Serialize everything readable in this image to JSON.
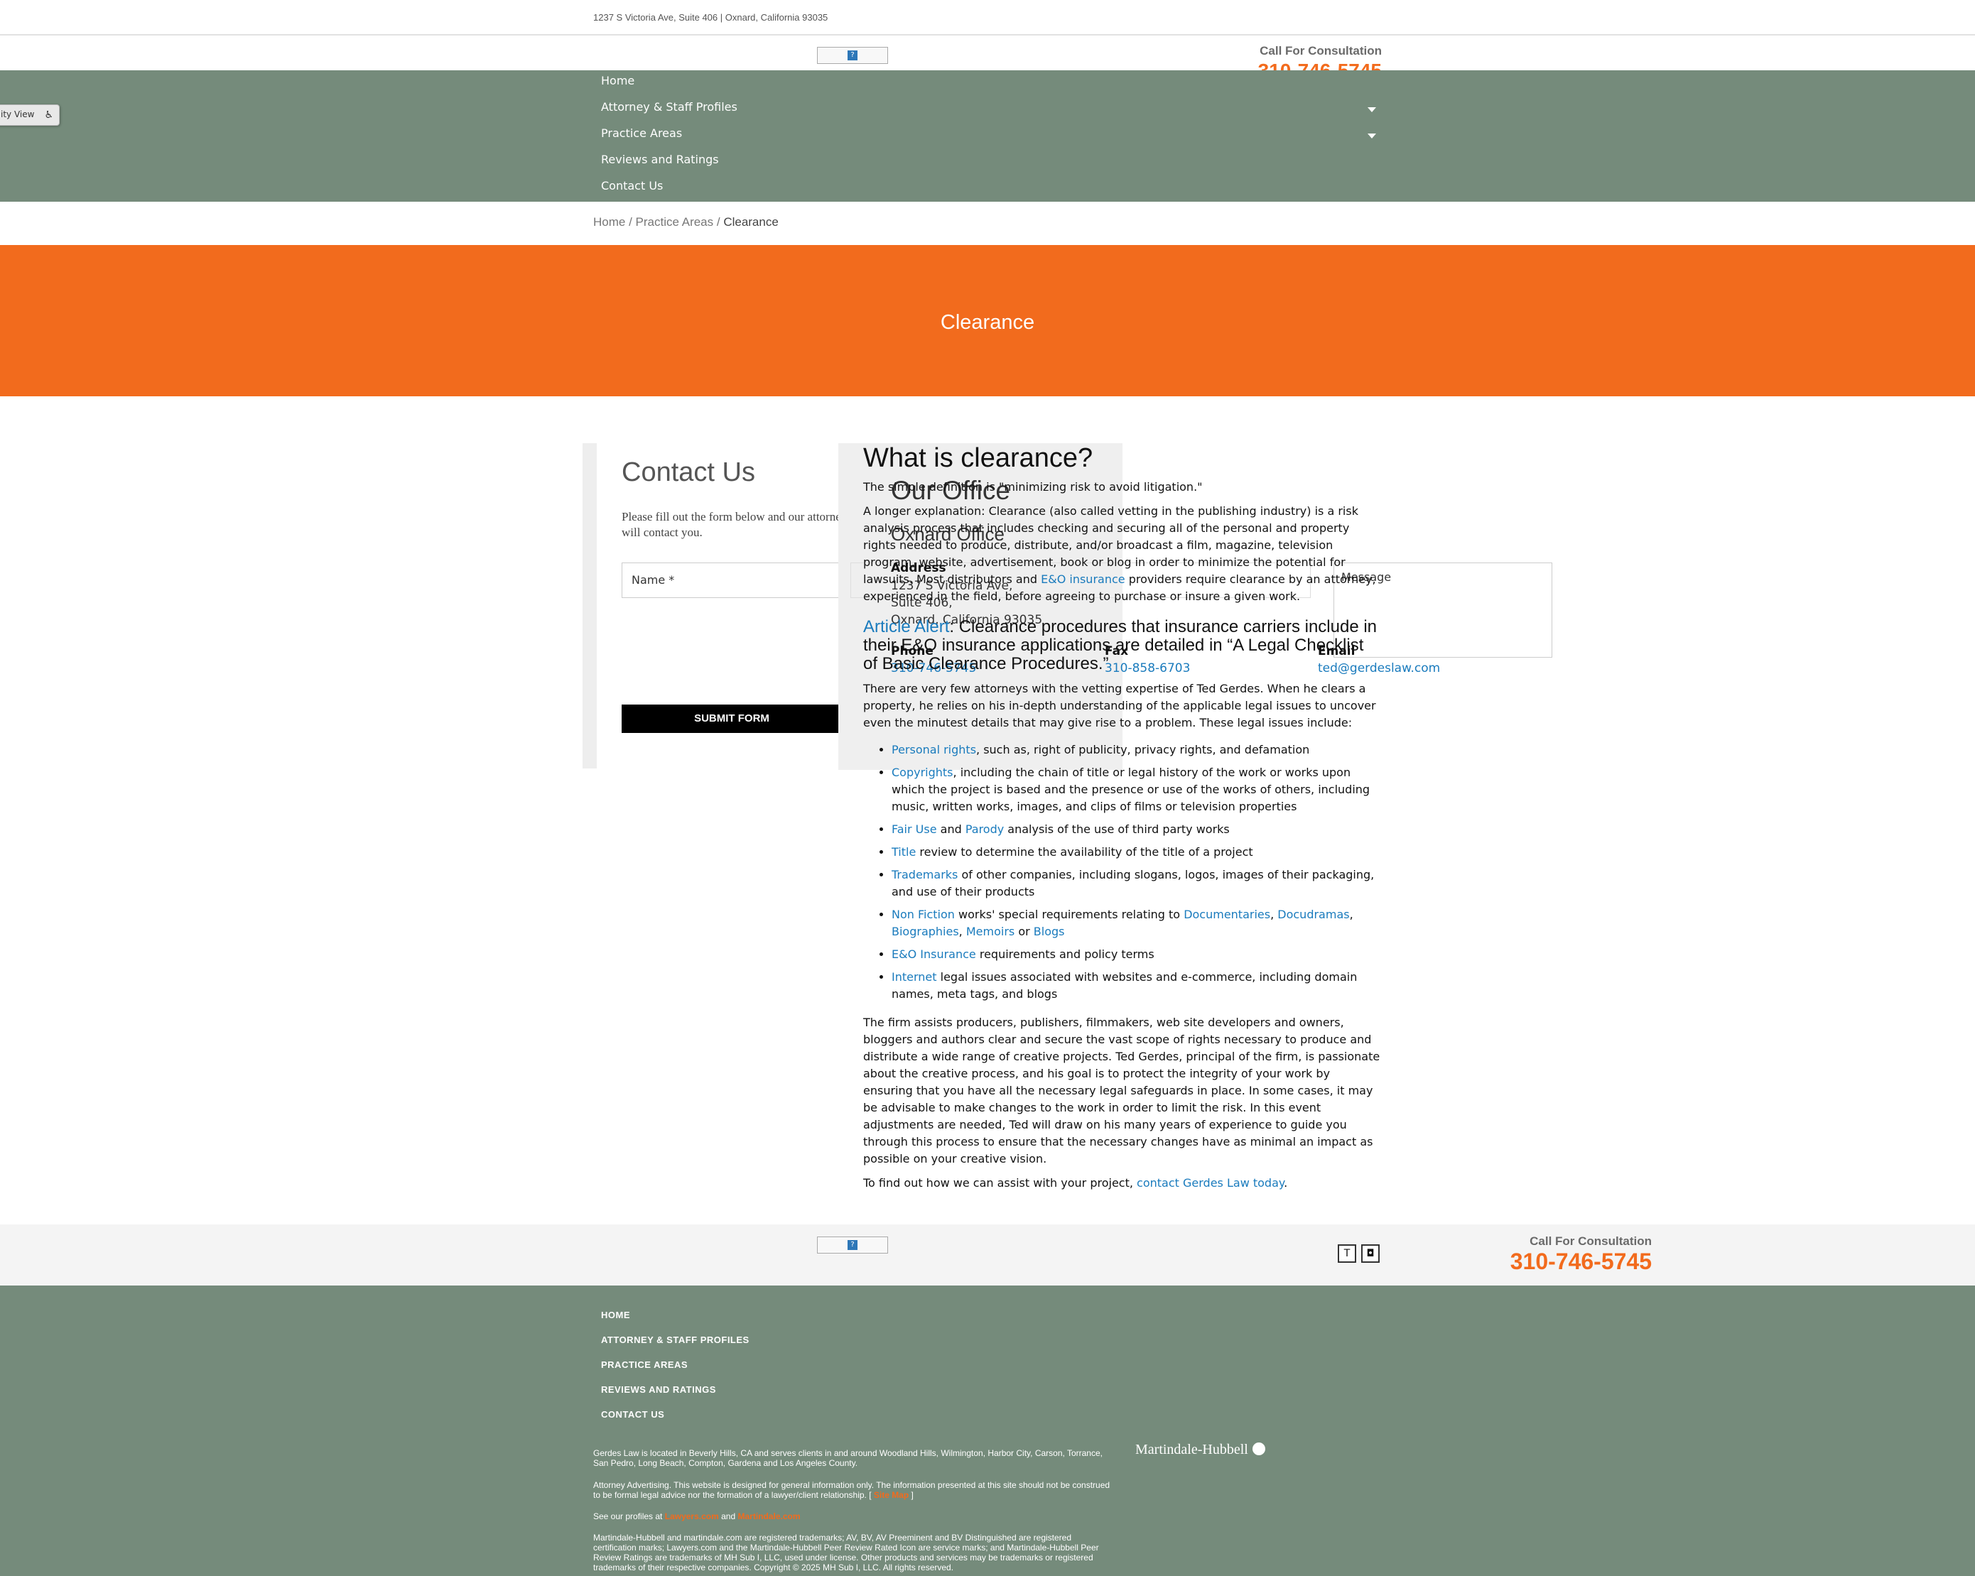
{
  "topbar": {
    "address": "1237 S Victoria Ave, Suite 406 | Oxnard, California 93035"
  },
  "header": {
    "logo_icon": "broken-image-icon",
    "cta_label": "Call For Consultation",
    "cta_phone": "310-746-5745"
  },
  "nav": {
    "items": [
      {
        "label": "Home"
      },
      {
        "label": "Attorney & Staff Profiles"
      },
      {
        "label": "Practice Areas"
      },
      {
        "label": "Reviews and Ratings"
      },
      {
        "label": "Contact Us"
      }
    ]
  },
  "accessibility": {
    "label": "ity View",
    "icon": "wheelchair-icon"
  },
  "breadcrumb": {
    "home": "Home",
    "sep1": " / ",
    "practice": "Practice Areas",
    "sep2": " / ",
    "current": "Clearance"
  },
  "hero": {
    "title": "Clearance"
  },
  "contact_form": {
    "title": "Contact Us",
    "intro": "Please fill out the form below and our attorney will contact you.",
    "name_label": "Name *",
    "message_label": "Message",
    "submit": "SUBMIT FORM"
  },
  "office": {
    "title": "Our Office",
    "name": "Oxnard Office",
    "address_label": "Address",
    "address_lines": [
      "1237 S Victoria Ave,",
      "Suite 406,",
      "Oxnard, California 93035"
    ],
    "phone_label": "Phone",
    "phone": "310-746-5745",
    "fax_label": "Fax",
    "fax": "310-858-6703",
    "email_label": "Email",
    "email": "ted@gerdeslaw.com"
  },
  "article": {
    "heading": "What is clearance?",
    "p1": "The simple definition is \"minimizing risk to avoid litigation.\"",
    "p2a": "A longer explanation: Clearance (also called vetting in the publishing industry) is a risk analysis process that includes checking and securing all of the personal and property rights needed to produce, distribute, and/or broadcast a film, magazine, television program, website, advertisement, book or blog in order to minimize the potential for lawsuits. Most distributors and ",
    "p2_link": "E&O insurance",
    "p2b": " providers require clearance by an attorney, experienced in the field, before agreeing to purchase or insure a given work.",
    "alert_link": "Article Alert",
    "alert_text": ": Clearance procedures that insurance carriers include in their E&O insurance applications are detailed in “A Legal Checklist of Basic Clearance Procedures.”",
    "p3": "There are very few attorneys with the vetting expertise of Ted Gerdes. When he clears a property, he relies on his in-depth understanding of the applicable legal issues to uncover even the minutest details that may give rise to a problem. These legal issues include:",
    "li1_link": "Personal rights",
    "li1_text": ", such as, right of publicity, privacy rights, and defamation",
    "li2_link": "Copyrights",
    "li2_text": ", including the chain of title or legal history of the work or works upon which the project is based and the presence or use of the works of others, including music, written works, images, and clips of films or television properties",
    "li3_link1": "Fair Use",
    "li3_and": " and ",
    "li3_link2": "Parody",
    "li3_text": " analysis of the use of third party works",
    "li4_link": "Title",
    "li4_text": " review to determine the availability of the title of a project",
    "li5_link": "Trademarks",
    "li5_text": " of other companies, including slogans, logos, images of their packaging, and use of their products",
    "li6_link1": "Non Fiction",
    "li6_text": " works' special requirements relating to ",
    "li6_link2": "Documentaries",
    "li6_c1": ", ",
    "li6_link3": "Docudramas",
    "li6_c2": ", ",
    "li6_link4": "Biographies",
    "li6_c3": ", ",
    "li6_link5": "Memoirs",
    "li6_or": " or ",
    "li6_link6": "Blogs",
    "li7_link": "E&O Insurance",
    "li7_text": " requirements and policy terms",
    "li8_link": "Internet",
    "li8_text": " legal issues associated with websites and e-commerce, including domain names, meta tags, and blogs",
    "p4": "The firm assists producers, publishers, filmmakers, web site developers and owners, bloggers and authors clear and secure the vast scope of rights necessary to produce and distribute a wide range of creative projects. Ted Gerdes, principal of the firm, is passionate about the creative process, and his goal is to protect the integrity of your work by ensuring that you have all the necessary legal safeguards in place. In some cases, it may be advisable to make changes to the work in order to limit the risk. In this event adjustments are needed, Ted will draw on his many years of experience to guide you through this process to ensure that the necessary changes have as minimal an impact as possible on your creative vision.",
    "p5a": "To find out how we can assist with your project, ",
    "p5_link": "contact Gerdes Law today",
    "p5b": "."
  },
  "prefooter": {
    "cta_label": "Call For Consultation",
    "cta_phone": "310-746-5745",
    "social1": "T",
    "social2": "◘"
  },
  "footer": {
    "nav": [
      "HOME",
      "ATTORNEY & STAFF PROFILES",
      "PRACTICE AREAS",
      "REVIEWS AND RATINGS",
      "CONTACT US"
    ],
    "locale": "Gerdes Law is located in Beverly Hills, CA and serves clients in and around Woodland Hills, Wilmington, Harbor City, Carson, Torrance, San Pedro, Long Beach, Compton, Gardena and Los Angeles County.",
    "disclaimer_a": "Attorney Advertising. This website is designed for general information only. The information presented at this site should not be construed to be formal legal advice nor the formation of a lawyer/client relationship. [ ",
    "disclaimer_link": "Site Map",
    "disclaimer_b": " ]",
    "profiles_a": "See our profiles at ",
    "profiles_link1": "Lawyers.com",
    "profiles_and": " and ",
    "profiles_link2": "Martindale.com",
    "trademark": "Martindale-Hubbell and martindale.com are registered trademarks; AV, BV, AV Preeminent and BV Distinguished are registered certification marks; Lawyers.com and the Martindale-Hubbell Peer Review Rated Icon are service marks; and Martindale-Hubbell Peer Review Ratings are trademarks of MH Sub I, LLC, used under license. Other products and services may be trademarks or registered trademarks of their respective companies. Copyright © 2025 MH Sub I, LLC. All rights reserved.",
    "mh_logo": "Martindale-Hubbell"
  }
}
